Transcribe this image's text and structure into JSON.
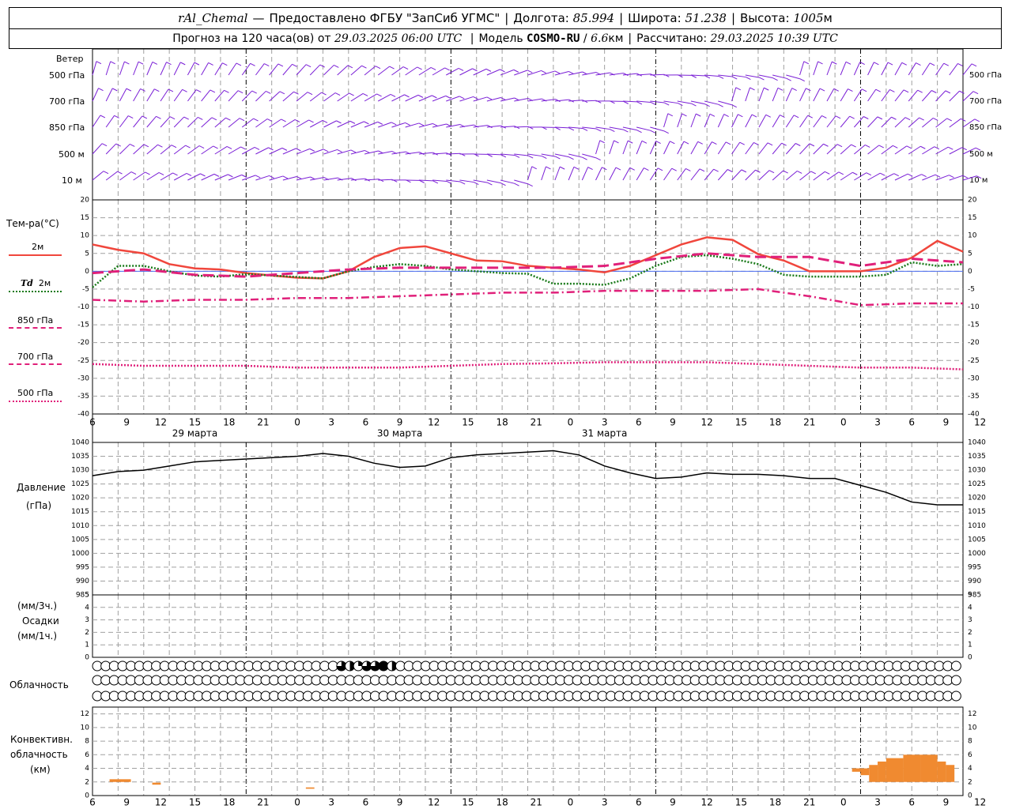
{
  "header": {
    "station": "rAl_Chemal",
    "provided_by": "Предоставлено ФГБУ \"ЗапСиб УГМС\"",
    "lon_label": "Долгота:",
    "lon_value": "85.994",
    "lat_label": "Широта:",
    "lat_value": "51.238",
    "alt_label": "Высота:",
    "alt_value": "1005",
    "alt_unit": "м",
    "forecast_prefix": "Прогноз на 120 часа(ов) от",
    "forecast_time": "29.03.2025 06:00 UTC",
    "model_label": "Модель",
    "model_name": "COSMO-RU",
    "model_res": "6.6",
    "model_res_unit": "км",
    "calc_label": "Рассчитано:",
    "calc_time": "29.03.2025 10:39 UTC"
  },
  "labels": {
    "wind": "Ветер",
    "wind_levels": [
      "500 гПа",
      "700 гПа",
      "850 гПа",
      "500 м",
      "10  м"
    ],
    "temp_title": "Тем-ра(°С)",
    "t2m": "2м",
    "td_prefix": "Td",
    "td_suffix": "2м",
    "t850": "850 гПа",
    "t700": "700 гПа",
    "t500": "500 гПа",
    "pressure_1": "Давление",
    "pressure_2": "(гПа)",
    "precip_1": "(мм/3ч.)",
    "precip_2": "Осадки",
    "precip_3": "(мм/1ч.)",
    "clouds": "Облачность",
    "conv_1": "Конвективн.",
    "conv_2": "облачность",
    "conv_3": "(км)"
  },
  "colors": {
    "t2m": "#f0463c",
    "td2m": "#1a7a1a",
    "t850": "#e0207a",
    "t700": "#e0207a",
    "t500": "#e0207a",
    "wind": "#7a1fd6",
    "pressure": "#000000",
    "conv": "#f08a30",
    "grid": "#a0a0a0"
  },
  "chart_data": {
    "type": "line",
    "x_axis": {
      "start_hour_utc": 6,
      "hours_span": 102,
      "tick_labels": [
        "6",
        "9",
        "12",
        "15",
        "18",
        "21",
        "0",
        "3",
        "6",
        "9",
        "12",
        "15",
        "18",
        "21",
        "0",
        "3",
        "6",
        "9",
        "12",
        "15",
        "18",
        "21",
        "0",
        "3",
        "6",
        "9",
        "12"
      ],
      "dates": [
        "29 марта",
        "30 марта",
        "31 марта"
      ]
    },
    "temperature": {
      "ylim": [
        -40,
        20
      ],
      "ticks": [
        20,
        15,
        10,
        5,
        0,
        -5,
        -10,
        -15,
        -20,
        -25,
        -30,
        -35,
        -40
      ],
      "series": [
        {
          "name": "2м",
          "style": "solid",
          "x": [
            0,
            3,
            6,
            9,
            12,
            15,
            18,
            21,
            24,
            27,
            30,
            33,
            36,
            39,
            42,
            45,
            48,
            51,
            54,
            57,
            60,
            63,
            66,
            69,
            72,
            75,
            78,
            81,
            84,
            87,
            90,
            93,
            96,
            99,
            102
          ],
          "y": [
            7.5,
            6,
            5,
            2,
            0.8,
            0.5,
            -0.5,
            -1.2,
            -1.8,
            -2,
            0,
            4,
            6.5,
            7,
            5,
            3,
            2.8,
            1.5,
            1,
            0.5,
            -0.3,
            1.5,
            4.5,
            7.5,
            9.5,
            8.8,
            4.8,
            3,
            0,
            0,
            0,
            1,
            3.8,
            8.5,
            5.5
          ]
        },
        {
          "name": "Td 2м",
          "style": "dotted",
          "x": [
            0,
            3,
            6,
            9,
            12,
            15,
            18,
            21,
            24,
            27,
            30,
            33,
            36,
            39,
            42,
            45,
            48,
            51,
            54,
            57,
            60,
            63,
            66,
            69,
            72,
            75,
            78,
            81,
            84,
            87,
            90,
            93,
            96,
            99,
            102
          ],
          "y": [
            -4.5,
            1.5,
            1.5,
            0,
            -1.2,
            -1.5,
            -0.8,
            -1.2,
            -1.6,
            -2,
            0,
            1.2,
            2,
            1.5,
            0.5,
            0,
            -0.5,
            -0.7,
            -3.5,
            -3.5,
            -3.8,
            -2,
            1.5,
            4,
            4.5,
            3.5,
            2,
            -1,
            -1.5,
            -1.5,
            -1.5,
            -1,
            2.5,
            1.5,
            2
          ]
        },
        {
          "name": "850 гПа",
          "style": "dashed",
          "x": [
            0,
            6,
            12,
            18,
            24,
            30,
            36,
            42,
            48,
            54,
            60,
            66,
            72,
            78,
            84,
            90,
            96,
            102
          ],
          "y": [
            -0.5,
            0.5,
            -1,
            -1.5,
            -0.5,
            0.5,
            1,
            1,
            1,
            1,
            1.5,
            3.5,
            5,
            4,
            4,
            1.5,
            3.5,
            2.5
          ]
        },
        {
          "name": "700 гПа",
          "style": "dashdot",
          "x": [
            0,
            6,
            12,
            18,
            24,
            30,
            36,
            42,
            48,
            54,
            60,
            66,
            72,
            78,
            84,
            90,
            96,
            102
          ],
          "y": [
            -8,
            -8.5,
            -8,
            -8,
            -7.5,
            -7.5,
            -7,
            -6.5,
            -6,
            -6,
            -5.5,
            -5.5,
            -5.5,
            -5,
            -7,
            -9.5,
            -9,
            -9
          ]
        },
        {
          "name": "500 гПа",
          "style": "dotted",
          "x": [
            0,
            6,
            12,
            18,
            24,
            30,
            36,
            42,
            48,
            54,
            60,
            66,
            72,
            78,
            84,
            90,
            96,
            102
          ],
          "y": [
            -26,
            -26.5,
            -26.5,
            -26.5,
            -27,
            -27,
            -27,
            -26.5,
            -26,
            -25.8,
            -25.5,
            -25.5,
            -25.5,
            -26,
            -26.5,
            -27,
            -27,
            -27.5
          ]
        }
      ]
    },
    "pressure": {
      "ylim": [
        985,
        1040
      ],
      "ticks": [
        1040,
        1035,
        1030,
        1025,
        1020,
        1015,
        1010,
        1005,
        1000,
        995,
        990,
        985
      ],
      "x": [
        0,
        3,
        6,
        9,
        12,
        15,
        18,
        21,
        24,
        27,
        30,
        33,
        36,
        39,
        42,
        45,
        48,
        51,
        54,
        57,
        60,
        63,
        66,
        69,
        72,
        75,
        78,
        81,
        84,
        87,
        90,
        93,
        96,
        99,
        102
      ],
      "y": [
        1028,
        1029.5,
        1030,
        1031.5,
        1033,
        1033.5,
        1034,
        1034.5,
        1035,
        1036,
        1035,
        1032.5,
        1031,
        1031.5,
        1034.5,
        1035.5,
        1036,
        1036.5,
        1037,
        1035.5,
        1031.5,
        1029,
        1027,
        1027.5,
        1029,
        1028.5,
        1028.5,
        1028,
        1027,
        1027,
        1024.5,
        1022,
        1018.5,
        1017.5,
        1017.5
      ]
    },
    "precip": {
      "ylim": [
        0,
        5
      ],
      "ticks": [
        5,
        4,
        3,
        2,
        1,
        0
      ],
      "values": []
    },
    "cloud_cover": {
      "rows": [
        "upper",
        "middle",
        "lower"
      ],
      "fraction_upper": [
        0,
        0,
        0,
        0,
        0,
        0,
        0,
        0,
        0,
        0,
        0,
        0,
        0,
        0,
        0,
        0,
        0,
        0,
        0,
        0,
        0,
        0,
        0,
        0,
        0,
        0,
        0,
        0,
        0,
        0.75,
        0.5,
        0.25,
        0.75,
        0.75,
        1,
        0.5,
        0,
        0,
        0,
        0,
        0,
        0,
        0,
        0,
        0,
        0,
        0,
        0,
        0,
        0,
        0,
        0,
        0,
        0,
        0,
        0,
        0,
        0,
        0,
        0,
        0,
        0,
        0,
        0,
        0,
        0,
        0,
        0,
        0,
        0,
        0,
        0,
        0,
        0,
        0,
        0,
        0,
        0,
        0,
        0,
        0,
        0,
        0,
        0,
        0,
        0,
        0,
        0,
        0,
        0,
        0,
        0,
        0,
        0,
        0,
        0,
        0,
        0,
        0,
        0,
        0,
        0,
        0
      ],
      "fraction_middle": [
        0,
        0,
        0,
        0,
        0,
        0,
        0,
        0,
        0,
        0,
        0,
        0,
        0,
        0,
        0,
        0,
        0,
        0,
        0,
        0,
        0,
        0,
        0,
        0,
        0,
        0,
        0,
        0,
        0,
        0,
        0,
        0,
        0,
        0,
        0,
        0,
        0,
        0,
        0,
        0,
        0,
        0,
        0,
        0,
        0,
        0,
        0,
        0,
        0,
        0,
        0,
        0,
        0,
        0,
        0,
        0,
        0,
        0,
        0,
        0,
        0,
        0,
        0,
        0,
        0,
        0,
        0,
        0,
        0,
        0,
        0,
        0,
        0,
        0,
        0,
        0,
        0,
        0,
        0,
        0,
        0,
        0,
        0,
        0,
        0,
        0,
        0,
        0,
        0,
        0,
        0,
        0,
        0,
        0,
        0,
        0,
        0,
        0,
        0,
        0,
        0,
        0,
        0
      ],
      "fraction_lower": [
        0,
        0,
        0,
        0,
        0,
        0,
        0,
        0,
        0,
        0,
        0,
        0,
        0,
        0,
        0,
        0,
        0,
        0,
        0,
        0,
        0,
        0,
        0,
        0,
        0,
        0,
        0,
        0,
        0,
        0,
        0,
        0,
        0,
        0,
        0,
        0,
        0,
        0,
        0,
        0,
        0,
        0,
        0,
        0,
        0,
        0,
        0,
        0,
        0,
        0,
        0,
        0,
        0,
        0,
        0,
        0,
        0,
        0,
        0,
        0,
        0,
        0,
        0,
        0,
        0,
        0,
        0,
        0,
        0,
        0,
        0,
        0,
        0,
        0,
        0,
        0,
        0,
        0,
        0,
        0,
        0,
        0,
        0,
        0,
        0,
        0,
        0,
        0,
        0,
        0,
        0,
        0,
        0,
        0,
        0,
        0,
        0,
        0,
        0,
        0,
        0,
        0,
        0
      ]
    },
    "convective": {
      "ylim": [
        0,
        13
      ],
      "ticks": [
        12,
        10,
        8,
        6,
        4,
        2,
        0
      ],
      "bars": [
        {
          "x0": 2,
          "x1": 4.5,
          "bottom": 2,
          "top": 2.4
        },
        {
          "x0": 7,
          "x1": 8,
          "bottom": 1.6,
          "top": 1.9
        },
        {
          "x0": 25,
          "x1": 26,
          "bottom": 1,
          "top": 1.2
        },
        {
          "x0": 89,
          "x1": 90,
          "bottom": 3.5,
          "top": 4
        },
        {
          "x0": 90,
          "x1": 91,
          "bottom": 3,
          "top": 4
        },
        {
          "x0": 91,
          "x1": 92,
          "bottom": 2,
          "top": 4.5
        },
        {
          "x0": 92,
          "x1": 93,
          "bottom": 2,
          "top": 5
        },
        {
          "x0": 93,
          "x1": 95,
          "bottom": 2,
          "top": 5.5
        },
        {
          "x0": 95,
          "x1": 97,
          "bottom": 2,
          "top": 6
        },
        {
          "x0": 97,
          "x1": 99,
          "bottom": 2,
          "top": 6
        },
        {
          "x0": 99,
          "x1": 100,
          "bottom": 2,
          "top": 5
        },
        {
          "x0": 100,
          "x1": 101,
          "bottom": 2,
          "top": 4.5
        }
      ]
    }
  }
}
